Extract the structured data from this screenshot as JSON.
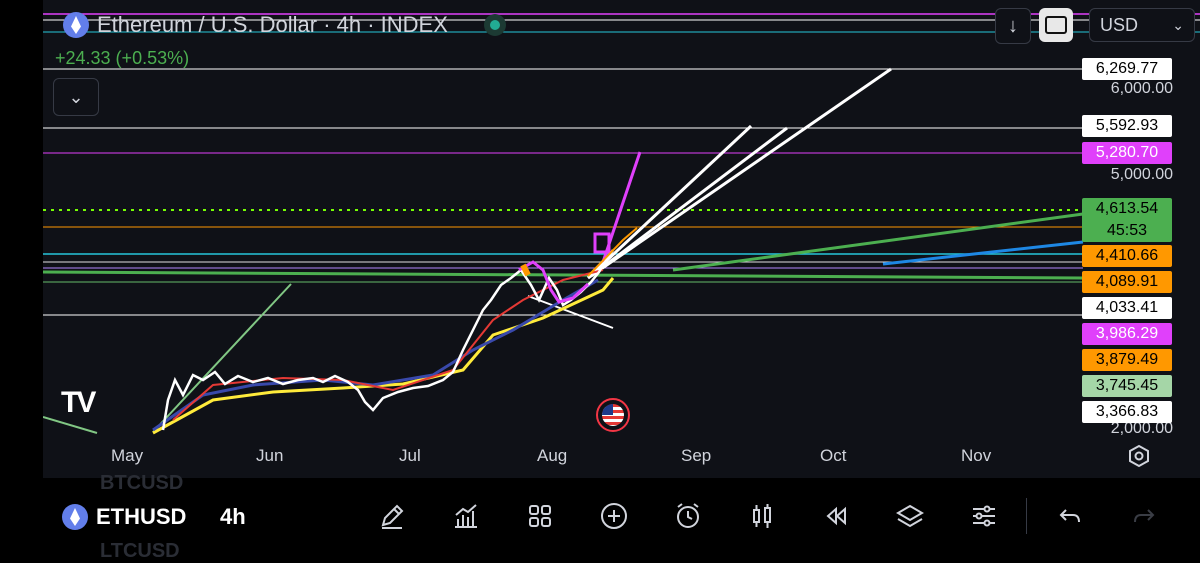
{
  "header": {
    "title": "Ethereum / U.S. Dollar · 4h · INDEX",
    "change": "+24.33 (+0.53%)",
    "currency": "USD"
  },
  "price_axis": {
    "labels": [
      "6,000.00",
      "5,000.00",
      "2,000.00"
    ],
    "tags": [
      {
        "text": "6,269.77",
        "bg": "#ffffff",
        "fg": "#000000"
      },
      {
        "text": "5,592.93",
        "bg": "#ffffff",
        "fg": "#000000"
      },
      {
        "text": "5,280.70",
        "bg": "#e040fb",
        "fg": "#ffffff"
      },
      {
        "text": "4,613.54",
        "sub": "45:53",
        "bg": "#4caf50",
        "fg": "#000000"
      },
      {
        "text": "4,410.66",
        "bg": "#ff9800",
        "fg": "#000000"
      },
      {
        "text": "4,089.91",
        "bg": "#ff9800",
        "fg": "#000000"
      },
      {
        "text": "4,033.41",
        "bg": "#ffffff",
        "fg": "#000000"
      },
      {
        "text": "3,986.29",
        "bg": "#e040fb",
        "fg": "#ffffff"
      },
      {
        "text": "3,879.49",
        "bg": "#ff9800",
        "fg": "#000000"
      },
      {
        "text": "3,745.45",
        "bg": "#a5d6a7",
        "fg": "#000000"
      },
      {
        "text": "3,366.83",
        "bg": "#ffffff",
        "fg": "#000000"
      }
    ]
  },
  "time_axis": {
    "months": [
      "May",
      "Jun",
      "Jul",
      "Aug",
      "Sep",
      "Oct",
      "Nov"
    ]
  },
  "toolbar": {
    "symbol": "ETHUSD",
    "ghost_top": "BTCUSD",
    "ghost_bottom": "LTCUSD",
    "interval": "4h",
    "tools": [
      "pen-icon",
      "indicators-icon",
      "grid-icon",
      "plus-circle-icon",
      "alarm-icon",
      "candles-icon",
      "replay-icon",
      "layers-icon",
      "settings-sliders-icon",
      "undo-icon",
      "redo-icon"
    ]
  },
  "colors": {
    "accent_green": "#4caf50",
    "background": "#0f1117"
  }
}
